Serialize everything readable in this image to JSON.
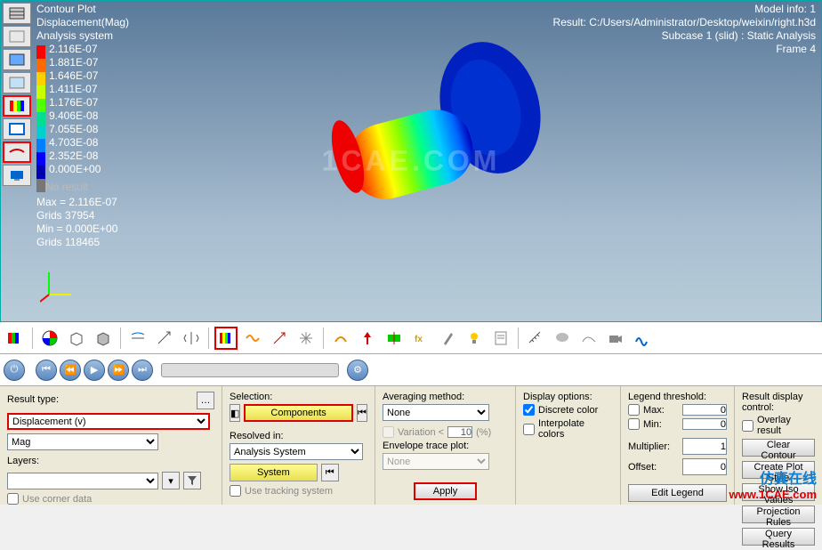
{
  "overlay": {
    "title": "Contour Plot",
    "subtitle": "Displacement(Mag)",
    "system": "Analysis system",
    "noresult": "No result",
    "max_line": "Max = 2.116E-07",
    "max_grids": "Grids 37954",
    "min_line": "Min = 0.000E+00",
    "min_grids": "Grids 118465",
    "model_info": "Model info: 1",
    "result_path": "Result: C:/Users/Administrator/Desktop/weixin/right.h3d",
    "subcase": "Subcase 1 (slid) : Static Analysis",
    "frame": "Frame 4"
  },
  "legend": {
    "items": [
      {
        "value": "2.116E-07",
        "color": "#ff0000"
      },
      {
        "value": "1.881E-07",
        "color": "#ff6a00"
      },
      {
        "value": "1.646E-07",
        "color": "#ffd000"
      },
      {
        "value": "1.411E-07",
        "color": "#c8ff00"
      },
      {
        "value": "1.176E-07",
        "color": "#50ff00"
      },
      {
        "value": "9.406E-08",
        "color": "#00e090"
      },
      {
        "value": "7.055E-08",
        "color": "#00d0d0"
      },
      {
        "value": "4.703E-08",
        "color": "#0080ff"
      },
      {
        "value": "2.352E-08",
        "color": "#0000ff"
      },
      {
        "value": "0.000E+00",
        "color": "#0000b0"
      }
    ]
  },
  "watermark": "1CAE.COM",
  "controls": {
    "result_type_label": "Result type:",
    "result_type_value": "Displacement (v)",
    "mag_value": "Mag",
    "layers_label": "Layers:",
    "layers_value": "",
    "corner_data": "Use corner data",
    "selection_label": "Selection:",
    "components_btn": "Components",
    "resolved_label": "Resolved in:",
    "resolved_value": "Analysis System",
    "system_btn": "System",
    "tracking": "Use tracking system",
    "avg_label": "Averaging method:",
    "avg_value": "None",
    "variation": "Variation <",
    "variation_val": "10",
    "variation_unit": "(%)",
    "envelope_label": "Envelope trace plot:",
    "envelope_value": "None",
    "apply_btn": "Apply",
    "display_label": "Display options:",
    "discrete": "Discrete color",
    "interpolate": "Interpolate colors",
    "threshold_label": "Legend threshold:",
    "max_label": "Max:",
    "max_val": "0",
    "min_label": "Min:",
    "min_val": "0",
    "mult_label": "Multiplier:",
    "mult_val": "1",
    "offset_label": "Offset:",
    "offset_val": "0",
    "edit_legend_btn": "Edit Legend",
    "result_display_label": "Result display control:",
    "overlay_chk": "Overlay result",
    "clear_btn": "Clear Contour",
    "create_btn": "Create Plot Style",
    "iso_btn": "Show Iso Values",
    "proj_btn": "Projection Rules",
    "query_btn": "Query Results"
  },
  "corner": {
    "cn": "仿真在线",
    "url": "www.1CAE.com"
  },
  "chart_data": {
    "type": "contour_legend",
    "title": "Displacement(Mag)",
    "units": "",
    "values": [
      2.116e-07,
      1.881e-07,
      1.646e-07,
      1.411e-07,
      1.176e-07,
      9.406e-08,
      7.055e-08,
      4.703e-08,
      2.352e-08,
      0.0
    ],
    "colors": [
      "#ff0000",
      "#ff6a00",
      "#ffd000",
      "#c8ff00",
      "#50ff00",
      "#00e090",
      "#00d0d0",
      "#0080ff",
      "#0000ff",
      "#0000b0"
    ],
    "max": 2.116e-07,
    "min": 0.0
  }
}
